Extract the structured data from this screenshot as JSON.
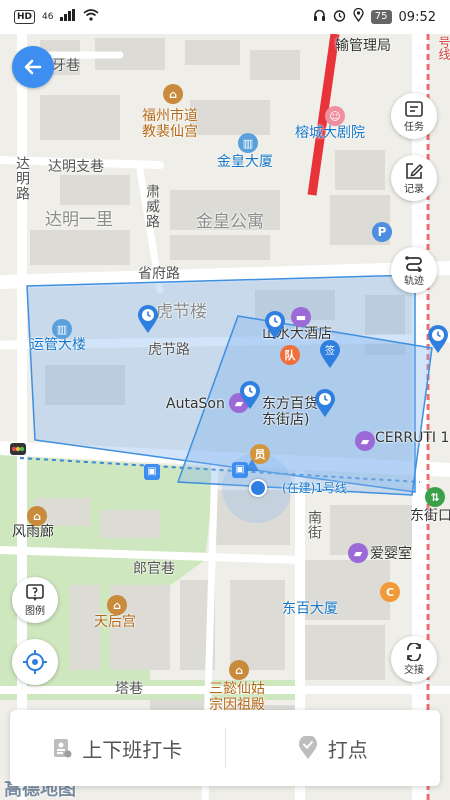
{
  "status_bar": {
    "hd": "HD",
    "network": "46",
    "battery": "75",
    "time": "09:52"
  },
  "map": {
    "roads": {
      "shengfu_road": "省府路",
      "hujie_road": "虎节路",
      "langguan_lane": "郎官巷",
      "ta_lane": "塔巷",
      "daming_branch_lane": "达明支巷",
      "daming_road": "达明路",
      "suwei_road": "肃威路",
      "nanjie": "南街",
      "yaxiang": "牙巷",
      "top_right_fragment": "号线"
    },
    "labels": {
      "fuzhou_temple": "福州市道\n教裴仙宫",
      "transport_bureau": "输管理局",
      "rongcheng_theater": "榕城大剧院",
      "jinhuang_tower": "金皇大厦",
      "jinhuang_apartment": "金皇公寓",
      "daming_yili": "达明一里",
      "yunguan_tower": "运管大楼",
      "hujie_building": "虎节楼",
      "hotel": "山水大酒店",
      "autason": "AutaSon",
      "dongfang_dept": "东方百货\n东街店)",
      "cerruti": "CERRUTI 1",
      "dongjiekou": "东街口",
      "fengyulang": "风雨廊",
      "aiying": "爱婴室",
      "dongbai_tower": "东百大厦",
      "tianhou_temple": "天后宫",
      "sanyi_shrine": "三懿仙姑\n宗因祖殿",
      "metro_station": "(在建)1号线",
      "map_brand": "高德地图"
    },
    "poi_badges": {
      "team": "队",
      "staff": "员"
    },
    "geofence_color": "#3f8fe0",
    "metro_line_color": "#e8333a"
  },
  "toolbar": {
    "tasks": "任务",
    "records": "记录",
    "track": "轨迹",
    "handover": "交接",
    "legend": "图例"
  },
  "bottom_bar": {
    "clock_in": "上下班打卡",
    "checkpoint": "打点"
  },
  "icons": {
    "back": "arrow-left-icon",
    "tasks": "task-list-icon",
    "records": "pencil-edit-icon",
    "track": "route-icon",
    "handover": "swap-icon",
    "legend": "help-icon",
    "locate": "crosshair-icon",
    "clock_in": "id-card-icon",
    "checkpoint": "location-check-icon"
  }
}
